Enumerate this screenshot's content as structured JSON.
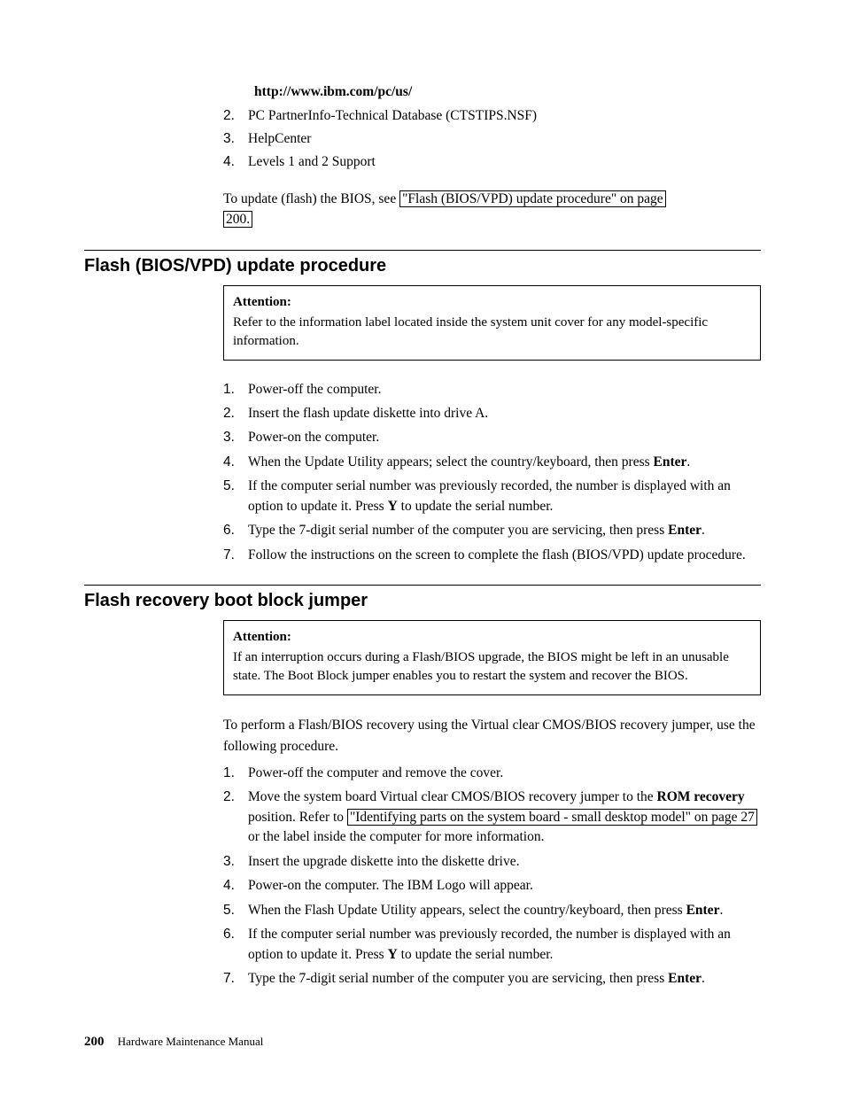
{
  "top": {
    "url": "http://www.ibm.com/pc/us/",
    "items": [
      {
        "n": "2.",
        "text": "PC PartnerInfo-Technical Database (CTSTIPS.NSF)"
      },
      {
        "n": "3.",
        "text": "HelpCenter"
      },
      {
        "n": "4.",
        "text": "Levels 1 and 2 Support"
      }
    ],
    "para_pre": "To update (flash) the BIOS, see ",
    "para_link1": "\"Flash (BIOS/VPD) update procedure\" on page",
    "para_link2": "200."
  },
  "sec1": {
    "heading": "Flash (BIOS/VPD) update procedure",
    "attn_title": "Attention:",
    "attn_body": "Refer to the information label located inside the system unit cover for any model-specific information.",
    "steps": [
      {
        "n": "1.",
        "t1": "Power-off the computer."
      },
      {
        "n": "2.",
        "t1": "Insert the flash update diskette into drive A."
      },
      {
        "n": "3.",
        "t1": "Power-on the computer."
      },
      {
        "n": "4.",
        "t1": "When the Update Utility appears; select the country/keyboard, then press ",
        "b1": "Enter",
        "t2": "."
      },
      {
        "n": "5.",
        "t1": "If the computer serial number was previously recorded, the number is displayed with an option to update it. Press ",
        "b1": "Y",
        "t2": " to update the serial number."
      },
      {
        "n": "6.",
        "t1": "Type the 7-digit serial number of the computer you are servicing, then press ",
        "b1": "Enter",
        "t2": "."
      },
      {
        "n": "7.",
        "t1": "Follow the instructions on the screen to complete the flash (BIOS/VPD) update procedure."
      }
    ]
  },
  "sec2": {
    "heading": "Flash recovery boot block jumper",
    "attn_title": "Attention:",
    "attn_body": "If an interruption occurs during a Flash/BIOS upgrade, the BIOS might be left in an unusable state. The Boot Block jumper enables you to restart the system and recover the BIOS.",
    "intro": "To perform a Flash/BIOS recovery using the Virtual clear CMOS/BIOS recovery jumper, use the following procedure.",
    "s1n": "1.",
    "s1t": "Power-off the computer and remove the cover.",
    "s2n": "2.",
    "s2_t1": "Move the system board Virtual clear CMOS/BIOS recovery jumper to the ",
    "s2_b1": "ROM recovery",
    "s2_t2": " position. Refer to ",
    "s2_link": "\"Identifying parts on the system board - small desktop model\" on page 27",
    "s2_t3": " or the label inside the computer for more information.",
    "s3n": "3.",
    "s3t": "Insert the upgrade diskette into the diskette drive.",
    "s4n": "4.",
    "s4t": "Power-on the computer. The IBM Logo will appear.",
    "s5n": "5.",
    "s5_t1": "When the Flash Update Utility appears, select the country/keyboard, then press ",
    "s5_b1": "Enter",
    "s5_t2": ".",
    "s6n": "6.",
    "s6_t1": "If the computer serial number was previously recorded, the number is displayed with an option to update it. Press ",
    "s6_b1": "Y",
    "s6_t2": " to update the serial number.",
    "s7n": "7.",
    "s7_t1": "Type the 7-digit serial number of the computer you are servicing, then press ",
    "s7_b1": "Enter",
    "s7_t2": "."
  },
  "footer": {
    "page": "200",
    "title": "Hardware Maintenance Manual"
  }
}
